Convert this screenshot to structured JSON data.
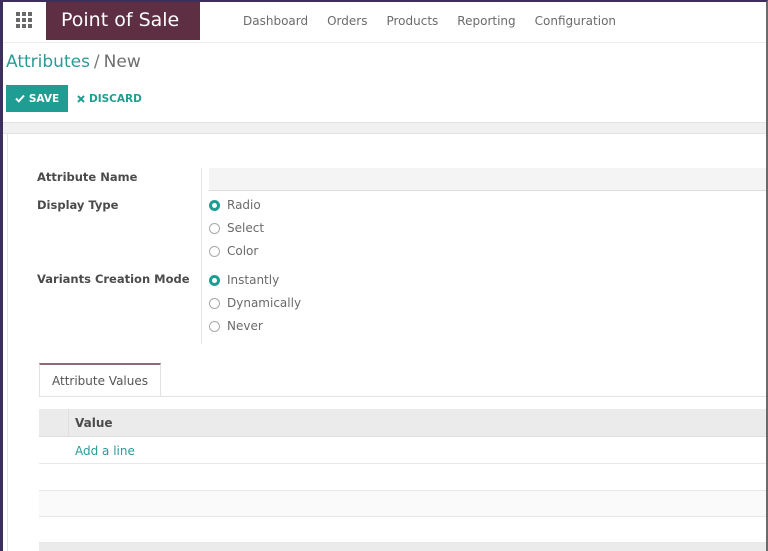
{
  "navbar": {
    "apps_icon": "grid-icon",
    "brand": "Point of Sale",
    "menu": [
      {
        "label": "Dashboard"
      },
      {
        "label": "Orders"
      },
      {
        "label": "Products"
      },
      {
        "label": "Reporting"
      },
      {
        "label": "Configuration"
      }
    ]
  },
  "breadcrumb": {
    "parent": "Attributes",
    "separator": "/",
    "current": "New"
  },
  "controls": {
    "save_icon": "check-icon",
    "save_label": "SAVE",
    "discard_icon": "close-icon",
    "discard_label": "DISCARD"
  },
  "form": {
    "attribute_name": {
      "label": "Attribute Name",
      "value": "",
      "placeholder": ""
    },
    "display_type": {
      "label": "Display Type",
      "options": [
        {
          "label": "Radio",
          "selected": true
        },
        {
          "label": "Select",
          "selected": false
        },
        {
          "label": "Color",
          "selected": false
        }
      ]
    },
    "variants_creation_mode": {
      "label": "Variants Creation Mode",
      "options": [
        {
          "label": "Instantly",
          "selected": true
        },
        {
          "label": "Dynamically",
          "selected": false
        },
        {
          "label": "Never",
          "selected": false
        }
      ]
    }
  },
  "notebook": {
    "tabs": [
      {
        "label": "Attribute Values",
        "active": true
      }
    ],
    "table": {
      "columns": [
        "Value"
      ],
      "add_line": "Add a line",
      "rows": []
    }
  },
  "colors": {
    "brand": "#5e2e42",
    "accent": "#1f9d93",
    "link": "#2c9a96"
  }
}
